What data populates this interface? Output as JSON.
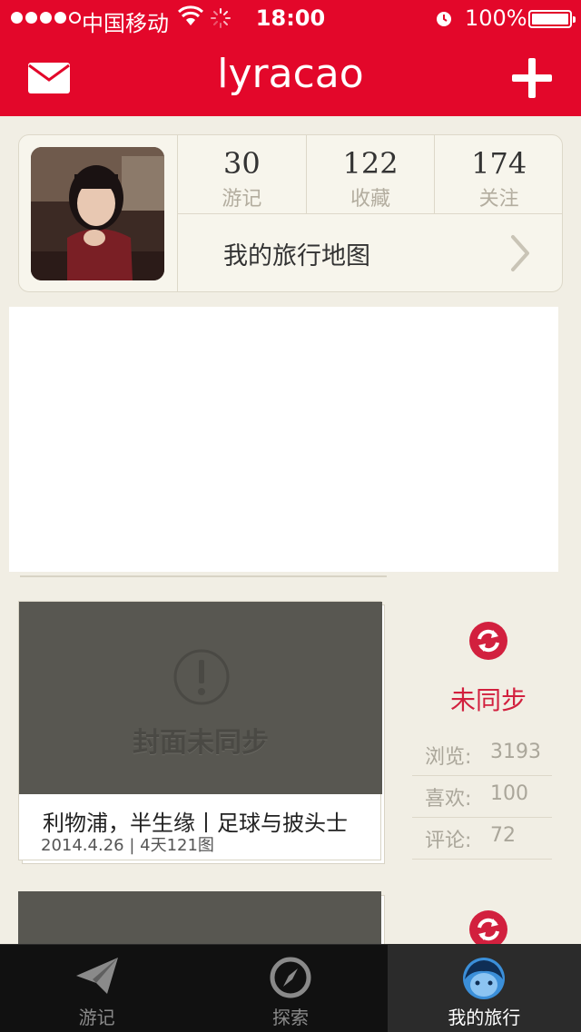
{
  "status_bar": {
    "carrier": "中国移动",
    "time": "18:00",
    "battery": "100%"
  },
  "nav": {
    "title": "lyracao"
  },
  "profile": {
    "stats": [
      {
        "value": "30",
        "label": "游记"
      },
      {
        "value": "122",
        "label": "收藏"
      },
      {
        "value": "174",
        "label": "关注"
      }
    ],
    "travel_map_label": "我的旅行地图"
  },
  "trips": [
    {
      "cover_placeholder": "封面未同步",
      "title": "利物浦，半生缘丨足球与披头士",
      "meta": "2014.4.26 | 4天121图",
      "sync_status": "未同步",
      "stats": [
        {
          "label": "浏览:",
          "value": "3193"
        },
        {
          "label": "喜欢:",
          "value": "100"
        },
        {
          "label": "评论:",
          "value": "72"
        }
      ]
    }
  ],
  "tabs": [
    {
      "label": "游记",
      "icon": "paper-plane-icon"
    },
    {
      "label": "探索",
      "icon": "compass-icon"
    },
    {
      "label": "我的旅行",
      "icon": "face-icon"
    }
  ],
  "colors": {
    "brand_red": "#e3072a",
    "sync_red": "#d2203e",
    "background": "#f1eee4"
  }
}
